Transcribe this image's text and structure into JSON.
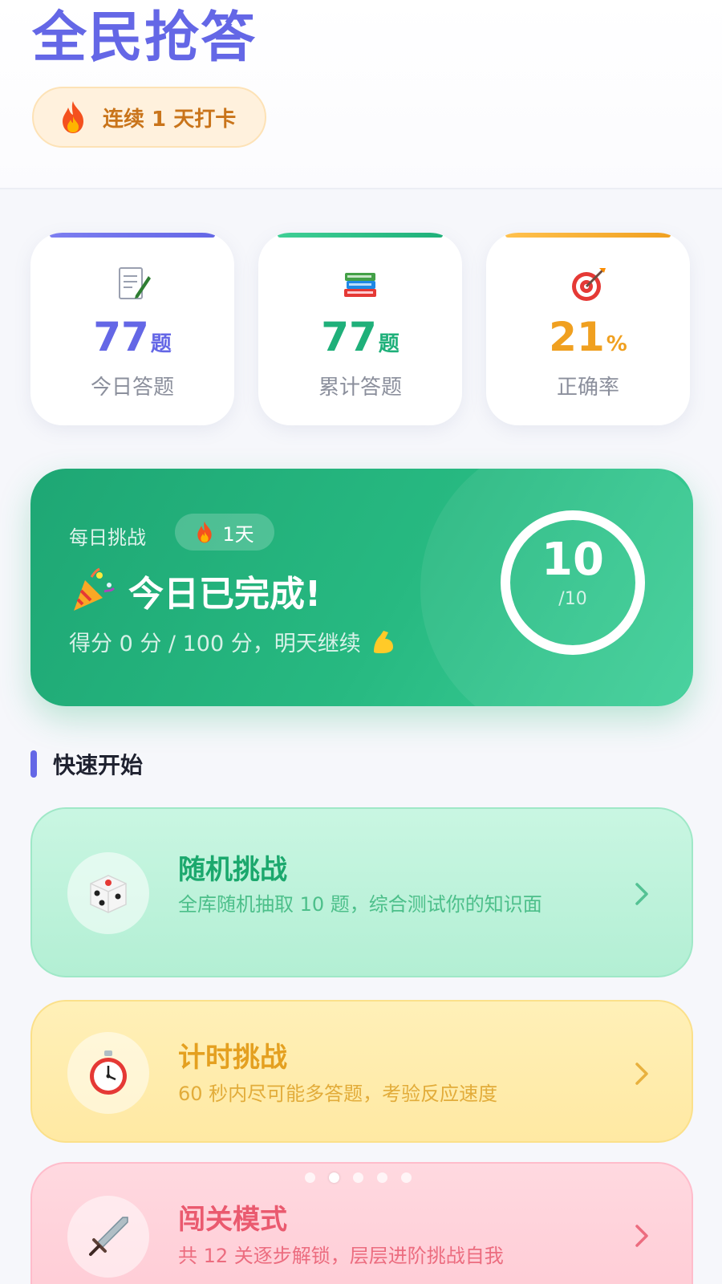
{
  "header": {
    "title": "全民抢答",
    "streak_text": "连续 1 天打卡"
  },
  "stats": [
    {
      "value": "77",
      "unit": "题",
      "label": "今日答题",
      "color": "#6467e6",
      "icon": "memo-icon"
    },
    {
      "value": "77",
      "unit": "题",
      "label": "累计答题",
      "color": "#1fb07a",
      "icon": "books-icon"
    },
    {
      "value": "21",
      "unit": "%",
      "label": "正确率",
      "color": "#f0a020",
      "icon": "target-icon"
    }
  ],
  "daily": {
    "tag": "每日挑战",
    "days": "1天",
    "status": "今日已完成!",
    "score_text": "得分 0 分 / 100 分，明天继续",
    "progress_value": "10",
    "progress_total": "/10",
    "progress_fraction": 1.0
  },
  "section": {
    "title": "快速开始"
  },
  "modes": [
    {
      "title": "随机挑战",
      "desc": "全库随机抽取 10 题，综合测试你的知识面",
      "icon": "dice-icon"
    },
    {
      "title": "计时挑战",
      "desc": "60 秒内尽可能多答题，考验反应速度",
      "icon": "stopwatch-icon"
    },
    {
      "title": "闯关模式",
      "desc": "共 12 关逐步解锁，层层进阶挑战自我",
      "icon": "sword-icon"
    }
  ],
  "pager": {
    "count": 5,
    "active_index": 1
  },
  "colors": {
    "brand": "#6467e6",
    "green": "#1fb07a",
    "orange": "#f0a020",
    "red": "#ea5a6f"
  }
}
